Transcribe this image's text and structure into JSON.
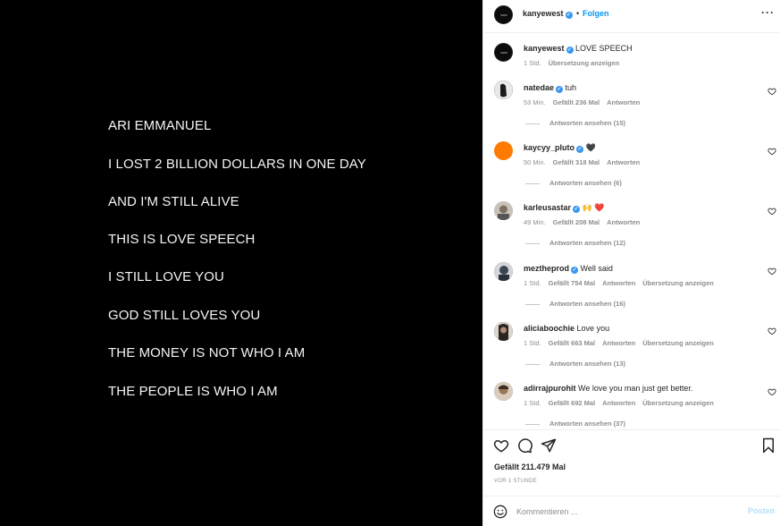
{
  "post": {
    "lines": [
      "ARI EMMANUEL",
      "I LOST 2 BILLION DOLLARS IN ONE DAY",
      "AND I'M STILL ALIVE",
      "THIS IS LOVE SPEECH",
      "I STILL LOVE YOU",
      "GOD STILL LOVES YOU",
      "THE MONEY IS NOT WHO I AM",
      "THE PEOPLE IS WHO I AM"
    ]
  },
  "header": {
    "username": "kanyewest",
    "separator": "•",
    "follow_label": "Folgen",
    "more_icon": "more-horizontal-icon"
  },
  "caption": {
    "username": "kanyewest",
    "text": "LOVE SPEECH",
    "time": "1 Std.",
    "translate_label": "Übersetzung anzeigen"
  },
  "comments": [
    {
      "username": "natedae",
      "verified": true,
      "text": "tuh",
      "time": "53 Min.",
      "likes": "Gefällt 236 Mal",
      "reply_label": "Antworten",
      "translate_label": "",
      "view_replies": "Antworten ansehen (15)",
      "avatar_color": "#1a1a1a"
    },
    {
      "username": "kaycyy_pluto",
      "verified": true,
      "text": "🖤",
      "time": "50 Min.",
      "likes": "Gefällt 318 Mal",
      "reply_label": "Antworten",
      "translate_label": "",
      "view_replies": "Antworten ansehen (6)",
      "avatar_color": "#ff7a00"
    },
    {
      "username": "karleusastar",
      "verified": true,
      "text": "🙌 ❤️",
      "time": "49 Min.",
      "likes": "Gefällt 208 Mal",
      "reply_label": "Antworten",
      "translate_label": "",
      "view_replies": "Antworten ansehen (12)",
      "avatar_color": "#a9a39b"
    },
    {
      "username": "meztheprod",
      "verified": true,
      "text": "Well said",
      "time": "1 Std.",
      "likes": "Gefällt 754 Mal",
      "reply_label": "Antworten",
      "translate_label": "Übersetzung anzeigen",
      "view_replies": "Antworten ansehen (16)",
      "avatar_color": "#5a6470"
    },
    {
      "username": "aliciaboochie",
      "verified": false,
      "text": "Love you",
      "time": "1 Std.",
      "likes": "Gefällt 663 Mal",
      "reply_label": "Antworten",
      "translate_label": "Übersetzung anzeigen",
      "view_replies": "Antworten ansehen (13)",
      "avatar_color": "#3e3a38"
    },
    {
      "username": "adirrajpurohit",
      "verified": false,
      "text": "We love you man just get better.",
      "time": "1 Std.",
      "likes": "Gefällt 692 Mal",
      "reply_label": "Antworten",
      "translate_label": "Übersetzung anzeigen",
      "view_replies": "Antworten ansehen (37)",
      "avatar_color": "#8a7a66"
    }
  ],
  "actions": {
    "likes": "Gefällt 211.479 Mal",
    "time_ago": "VOR 1 STUNDE"
  },
  "comment_box": {
    "placeholder": "Kommentieren ...",
    "post_label": "Posten"
  },
  "colors": {
    "accent": "#0095f6",
    "verified": "#3897f0",
    "muted": "#8e8e8e",
    "post_disabled": "#b2dffc"
  }
}
